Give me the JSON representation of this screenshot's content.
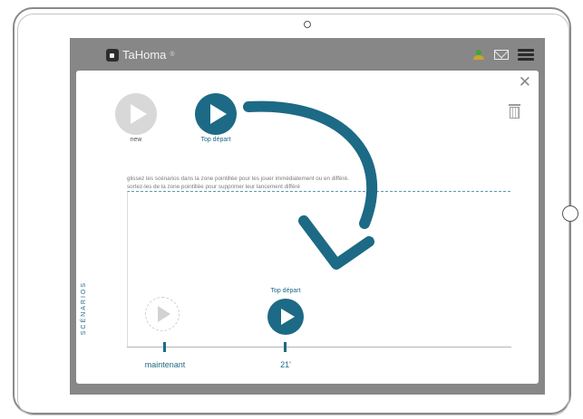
{
  "app": {
    "name": "TaHoma",
    "trademark": "®"
  },
  "header": {
    "icons": [
      "user-icon",
      "mail-icon",
      "menu-icon"
    ]
  },
  "panel": {
    "close_label": "✕",
    "scenarios": [
      {
        "label": "new",
        "state": "inactive"
      },
      {
        "label": "Top départ",
        "state": "active"
      }
    ],
    "instructions": [
      "glissez les scénarios dans la zone pointillée pour les jouer immédiatement ou en différé.",
      "sortez-les de la zone pointillée pour supprimer leur lancement différé"
    ],
    "section_label": "SCÉNARIOS",
    "timeline": {
      "now_label": "maintenant",
      "scheduled_label": "Top départ",
      "scheduled_time": "21'"
    }
  },
  "colors": {
    "accent": "#1c6a85",
    "screen_bg": "#878787",
    "inactive": "#d8d8d8"
  }
}
